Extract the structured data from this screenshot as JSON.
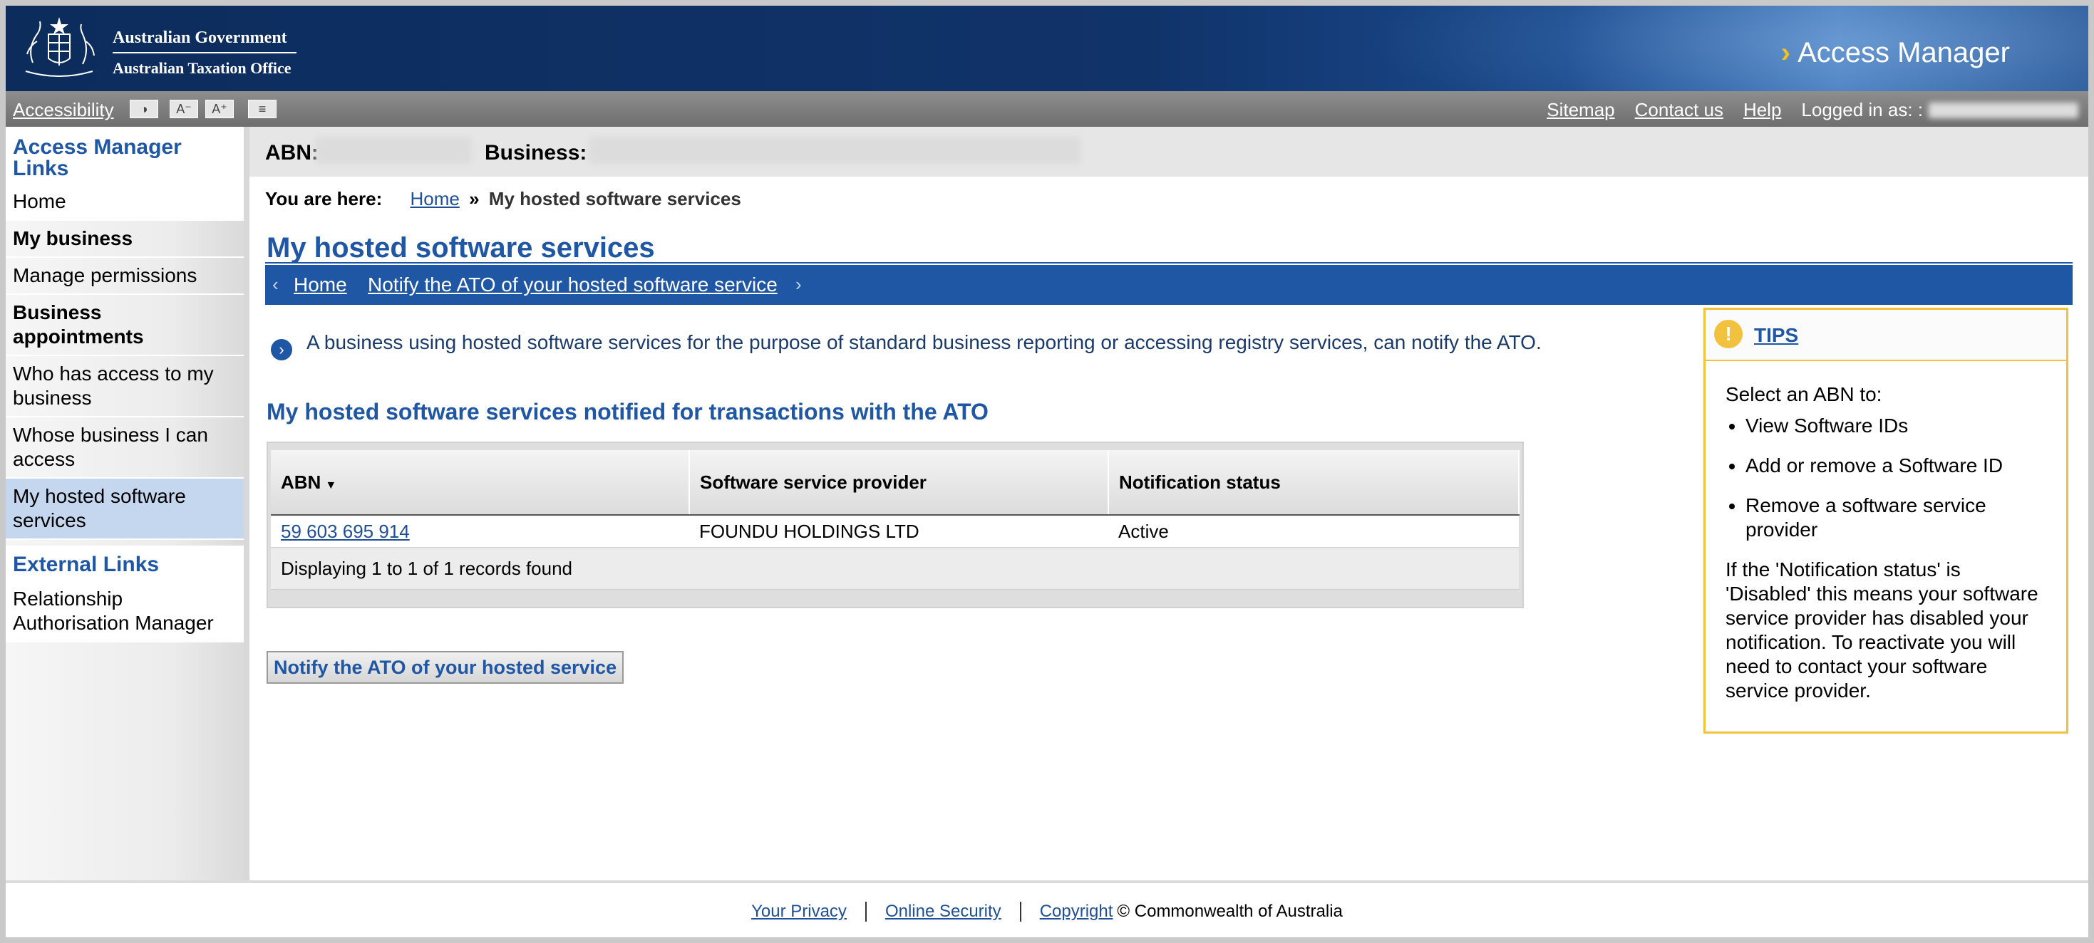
{
  "header": {
    "gov_line1": "Australian Government",
    "gov_line2": "Australian Taxation Office",
    "app_title": "Access Manager",
    "chevron": "›"
  },
  "utility_bar": {
    "accessibility_label": "Accessibility",
    "buttons": [
      "contrast-icon",
      "decrease-text-icon",
      "increase-text-icon",
      "text-only-icon"
    ],
    "sitemap": "Sitemap",
    "contact": "Contact us",
    "help": "Help",
    "logged_in_label": "Logged in as: :"
  },
  "left_nav": {
    "heading": "Access Manager Links",
    "items": [
      {
        "label": "Home",
        "bold": false
      },
      {
        "label": "My business",
        "bold": true
      },
      {
        "label": "Manage permissions",
        "bold": false
      },
      {
        "label": "Business appointments",
        "bold": true
      },
      {
        "label": "Who has access to my business",
        "bold": false
      },
      {
        "label": "Whose business I can access",
        "bold": false
      },
      {
        "label": "My hosted software services",
        "bold": false,
        "active": true
      }
    ],
    "external_heading": "External Links",
    "external_items": [
      {
        "label": "Relationship Authorisation Manager"
      }
    ]
  },
  "abn_bar": {
    "abn_label": "ABN:",
    "business_label": "Business:"
  },
  "breadcrumb": {
    "prefix": "You are here:",
    "home": "Home",
    "separator": "»",
    "current": "My hosted software services"
  },
  "page": {
    "title": "My hosted software services",
    "subnav_home": "Home",
    "subnav_notify": "Notify the ATO of your hosted software service",
    "intro": "A business using hosted software services for the purpose of standard business reporting or accessing registry services, can notify the ATO.",
    "section_heading": "My hosted software services notified for transactions with the ATO"
  },
  "table": {
    "columns": [
      "ABN",
      "Software service provider",
      "Notification status"
    ],
    "rows": [
      {
        "abn": "59 603 695 914",
        "provider": "FOUNDU HOLDINGS LTD",
        "status": "Active"
      }
    ],
    "footer": "Displaying 1 to 1 of 1 records found"
  },
  "notify_button": "Notify the ATO of your hosted service",
  "tips": {
    "title": "TIPS",
    "intro": "Select an ABN to:",
    "bullets": [
      "View Software IDs",
      "Add or remove a Software ID",
      "Remove a software service provider"
    ],
    "note": "If the 'Notification status' is 'Disabled' this means your software service provider has disabled your notification. To reactivate you will need to contact your software service provider."
  },
  "footer": {
    "privacy": "Your Privacy",
    "security": "Online Security",
    "copyright_link": "Copyright",
    "copyright_text": "© Commonwealth of Australia"
  },
  "colors": {
    "brand_blue": "#1f57a5",
    "banner_navy": "#0c2c5c",
    "tips_border": "#f2c13d",
    "active_nav": "#c5d7ee"
  }
}
